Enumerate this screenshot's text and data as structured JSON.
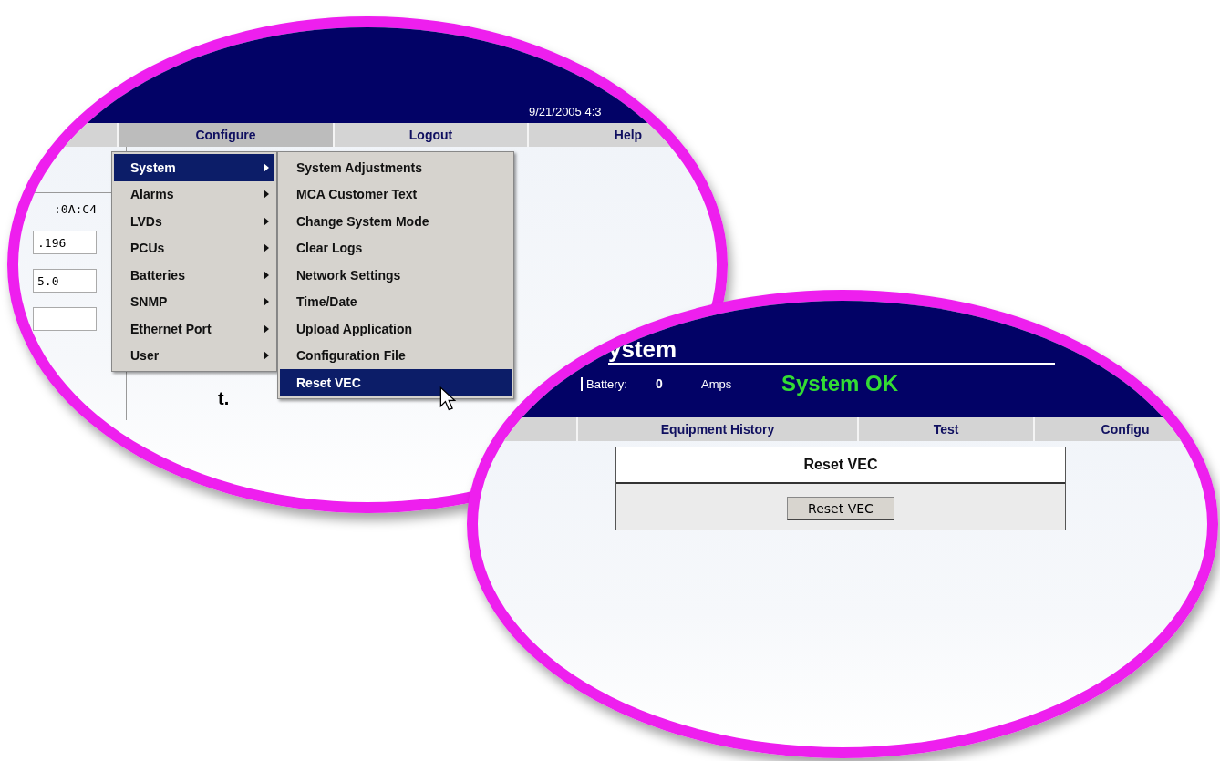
{
  "left_view": {
    "header": {
      "datetime": "9/21/2005 4:3"
    },
    "nav_tabs": [
      {
        "label": "Configure",
        "selected": true
      },
      {
        "label": "Logout",
        "selected": false
      },
      {
        "label": "Help",
        "selected": false
      }
    ],
    "side_panel": {
      "mac_fragment": ":0A:C4",
      "fields": [
        {
          "value": ".196"
        },
        {
          "value": "5.0"
        }
      ],
      "text_fragment": "t."
    },
    "menu": [
      {
        "label": "System",
        "selected": true
      },
      {
        "label": "Alarms",
        "selected": false
      },
      {
        "label": "LVDs",
        "selected": false
      },
      {
        "label": "PCUs",
        "selected": false
      },
      {
        "label": "Batteries",
        "selected": false
      },
      {
        "label": "SNMP",
        "selected": false
      },
      {
        "label": "Ethernet Port",
        "selected": false
      },
      {
        "label": "User",
        "selected": false
      }
    ],
    "submenu": [
      {
        "label": "System Adjustments",
        "selected": false
      },
      {
        "label": "MCA Customer Text",
        "selected": false
      },
      {
        "label": "Change System Mode",
        "selected": false
      },
      {
        "label": "Clear Logs",
        "selected": false
      },
      {
        "label": "Network Settings",
        "selected": false
      },
      {
        "label": "Time/Date",
        "selected": false
      },
      {
        "label": "Upload Application",
        "selected": false
      },
      {
        "label": "Configuration File",
        "selected": false
      },
      {
        "label": "Reset VEC",
        "selected": true
      }
    ]
  },
  "right_view": {
    "header": {
      "title": "ystem",
      "battery_label": "Battery:",
      "battery_value": "0",
      "battery_unit": "Amps",
      "status": "System OK"
    },
    "nav_tabs": [
      {
        "label": "Equipment History",
        "selected": false
      },
      {
        "label": "Test",
        "selected": false
      },
      {
        "label": "Configu",
        "selected": false
      }
    ],
    "panel": {
      "title": "Reset VEC",
      "button": "Reset VEC"
    }
  }
}
